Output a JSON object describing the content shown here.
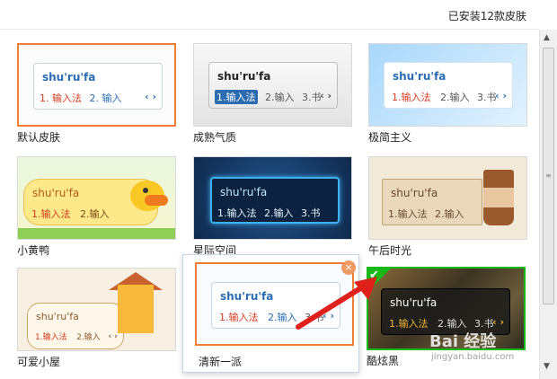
{
  "header": {
    "installed_count": "已安装12款皮肤"
  },
  "ime": {
    "pinyin": "shu'ru'fa",
    "cand1": "1.输入法",
    "cand2": "2.输入",
    "cand3": "3.书",
    "cand1_spaced": "1. 输入法",
    "cand2_spaced": "2. 输入",
    "nav": "‹ ›"
  },
  "skins": [
    {
      "name": "默认皮肤"
    },
    {
      "name": "成熟气质"
    },
    {
      "name": "极简主义"
    },
    {
      "name": "小黄鸭"
    },
    {
      "name": "星际空间"
    },
    {
      "name": "午后时光"
    },
    {
      "name": "可爱小屋"
    },
    {
      "name": "清新一派"
    },
    {
      "name": "酷炫黑"
    }
  ],
  "icons": {
    "close": "×",
    "check": "✔",
    "scroll_up": "▲",
    "scroll_down": "▼",
    "grip": "≡"
  },
  "colors": {
    "selected_border": "#ef7d33",
    "active_border": "#17b817",
    "arrow": "#e0201a"
  },
  "watermark": {
    "brand": "Bai 经验",
    "url": "jingyan.baidu.com"
  }
}
